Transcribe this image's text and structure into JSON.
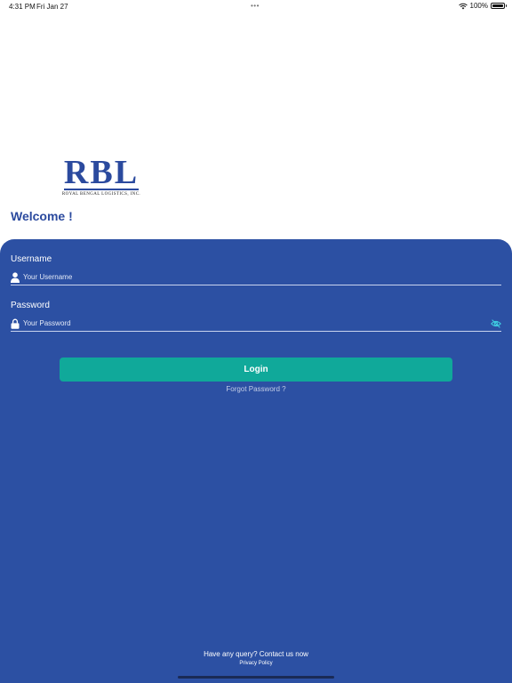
{
  "status_bar": {
    "time": "4:31 PM",
    "date": "Fri Jan 27",
    "dots": "•••",
    "battery": "100%",
    "battery_level": 1.0,
    "wifi_icon": "wifi-icon"
  },
  "logo": {
    "mark": "RBL",
    "subtitle": "ROYAL BENGAL LOGISTICS, INC."
  },
  "welcome": "Welcome !",
  "form": {
    "username_label": "Username",
    "username_placeholder": "Your Username",
    "username_value": "",
    "username_icon": "person-icon",
    "password_label": "Password",
    "password_placeholder": "Your Password",
    "password_value": "",
    "password_icon": "lock-icon",
    "visibility_icon": "eye-off-icon",
    "login_label": "Login",
    "forgot_label": "Forgot Password ?"
  },
  "footer": {
    "contact": "Have any query? Contact us now",
    "privacy": "Privacy Policy"
  },
  "colors": {
    "brand_blue": "#2c50a3",
    "logo_blue": "#2b4a9e",
    "accent_teal": "#10a99a"
  }
}
